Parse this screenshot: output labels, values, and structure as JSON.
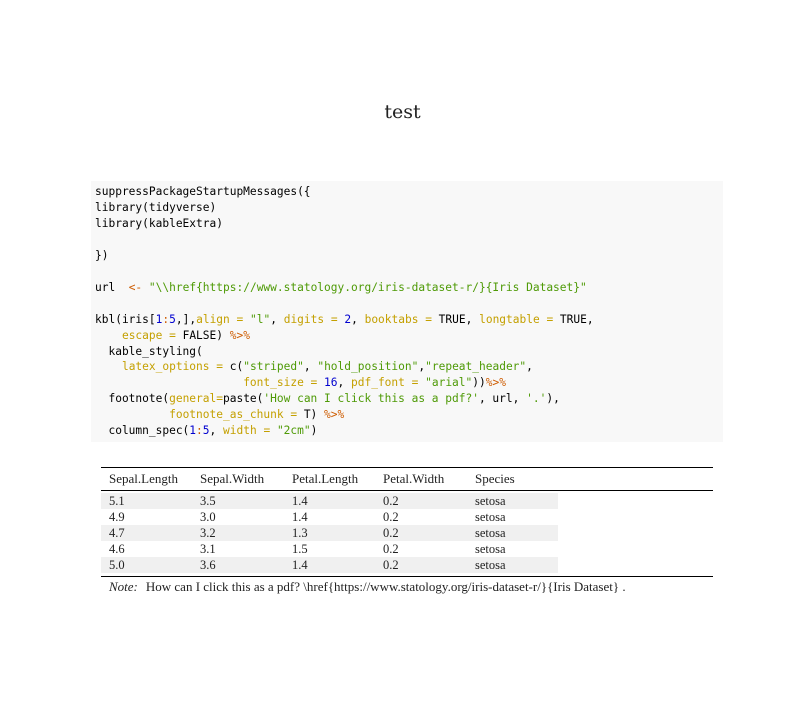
{
  "document": {
    "title": "test"
  },
  "code": {
    "language": "r",
    "lines": [
      "suppressPackageStartupMessages({",
      "library(tidyverse)",
      "library(kableExtra)",
      "",
      "})",
      "",
      "url  <- \"\\\\href{https://www.statology.org/iris-dataset-r/}{Iris Dataset}\"",
      "",
      "kbl(iris[1:5,],align = \"l\", digits = 2, booktabs = TRUE, longtable = TRUE,",
      "    escape = FALSE) %>%",
      "  kable_styling(",
      "    latex_options = c(\"striped\", \"hold_position\",\"repeat_header\",",
      "                      font_size = 16, pdf_font = \"arial\"))%>%",
      "  footnote(general=paste('How can I click this as a pdf?', url, '.'),",
      "           footnote_as_chunk = T) %>%",
      "  column_spec(1:5, width = \"2cm\")"
    ]
  },
  "table": {
    "columns": [
      "Sepal.Length",
      "Sepal.Width",
      "Petal.Length",
      "Petal.Width",
      "Species"
    ],
    "rows": [
      [
        "5.1",
        "3.5",
        "1.4",
        "0.2",
        "setosa"
      ],
      [
        "4.9",
        "3.0",
        "1.4",
        "0.2",
        "setosa"
      ],
      [
        "4.7",
        "3.2",
        "1.3",
        "0.2",
        "setosa"
      ],
      [
        "4.6",
        "3.1",
        "1.5",
        "0.2",
        "setosa"
      ],
      [
        "5.0",
        "3.6",
        "1.4",
        "0.2",
        "setosa"
      ]
    ],
    "note_label": "Note:",
    "note_text": "How can I click this as a pdf? \\href{https://www.statology.org/iris-dataset-r/}{Iris Dataset} ."
  },
  "colors": {
    "string": "#4e9a06",
    "argument": "#c4a000",
    "number": "#0000cf",
    "operator": "#ce5c00",
    "code_background": "#f8f8f8",
    "stripe": "#f0f0f0"
  }
}
